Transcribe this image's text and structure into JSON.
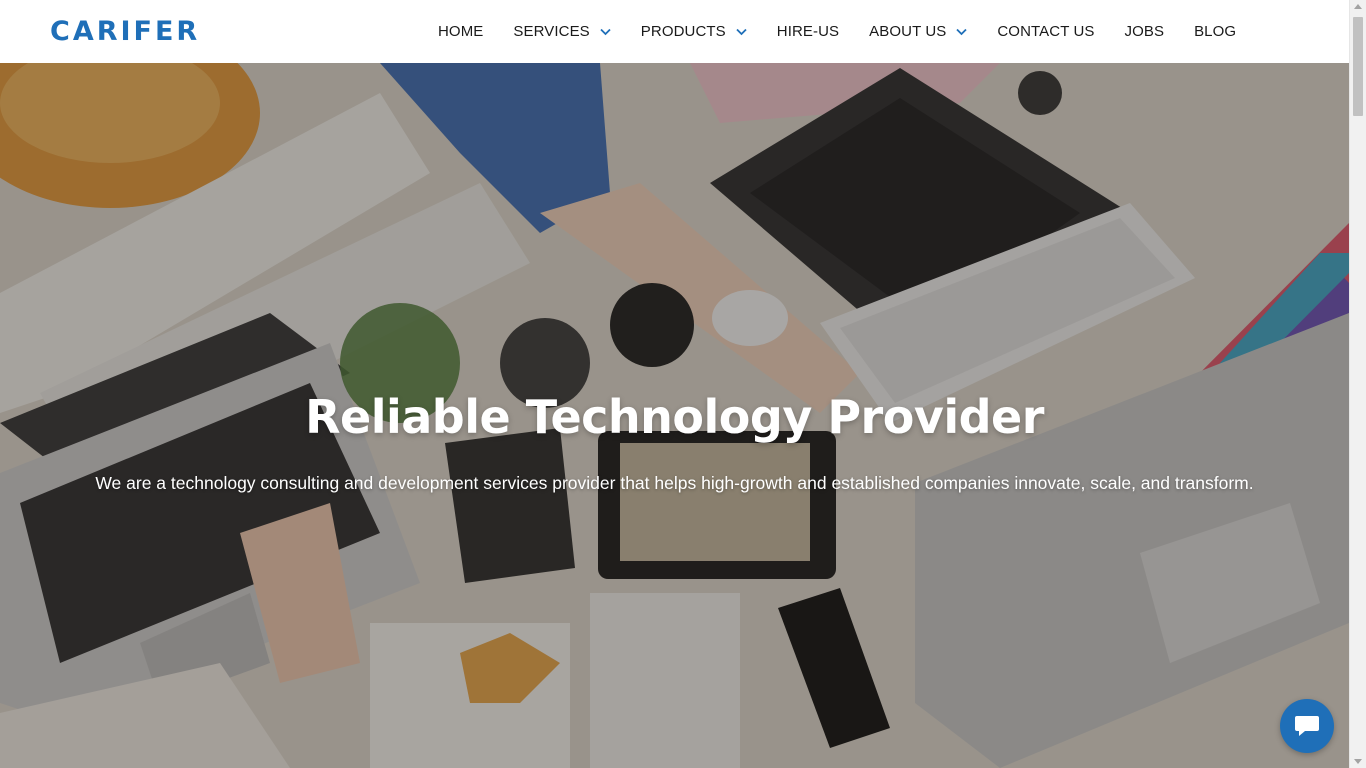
{
  "brand": {
    "logo_text": "CARIFER",
    "logo_color": "#1f6fb8"
  },
  "nav": {
    "items": [
      {
        "label": "HOME",
        "has_dropdown": false
      },
      {
        "label": "SERVICES",
        "has_dropdown": true
      },
      {
        "label": "PRODUCTS",
        "has_dropdown": true
      },
      {
        "label": "HIRE-US",
        "has_dropdown": false
      },
      {
        "label": "ABOUT US",
        "has_dropdown": true
      },
      {
        "label": "CONTACT US",
        "has_dropdown": false
      },
      {
        "label": "JOBS",
        "has_dropdown": false
      },
      {
        "label": "BLOG",
        "has_dropdown": false
      }
    ],
    "chevron_color": "#1f6fb8"
  },
  "hero": {
    "title": "Reliable Technology Provider",
    "subtitle": "We are a technology consulting and development services provider that helps high-growth and established companies innovate, scale, and transform.",
    "background_image": "desk-workspace-photo"
  },
  "chat_widget": {
    "icon": "chat-bubble-icon",
    "color": "#1f6fb8"
  }
}
